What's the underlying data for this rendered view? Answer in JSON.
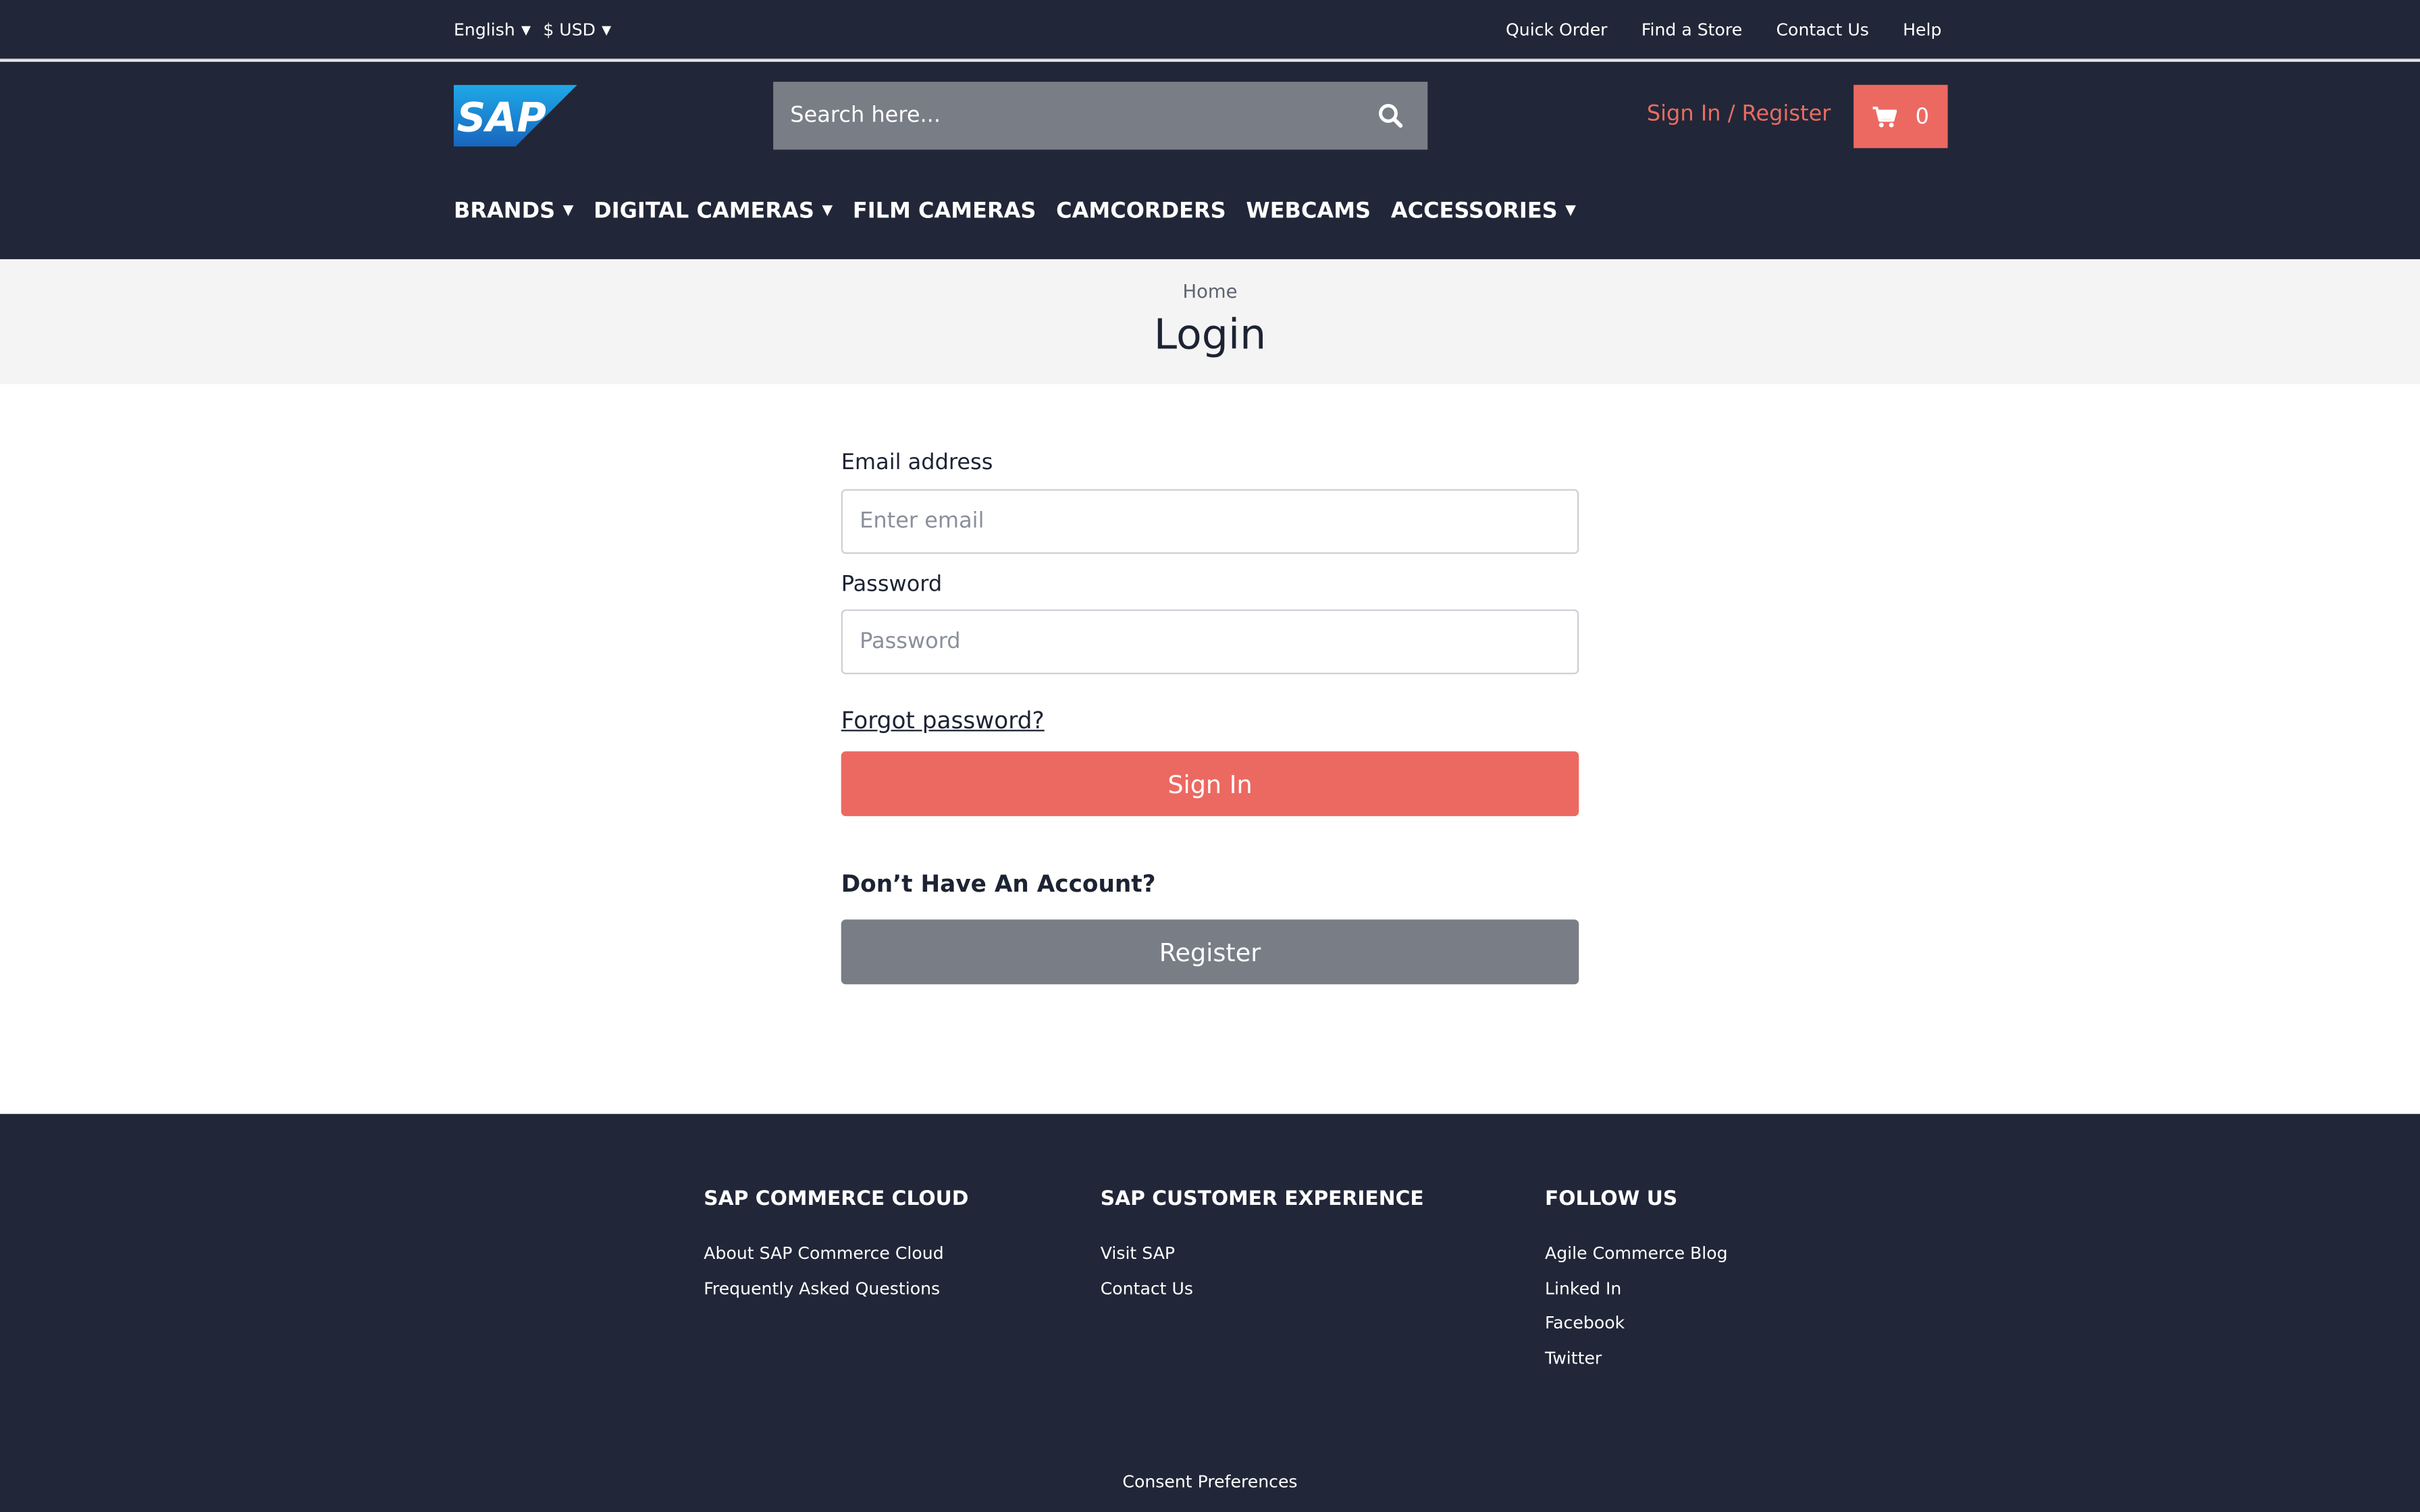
{
  "topbar": {
    "language": "English",
    "currency": "$ USD",
    "links": [
      "Quick Order",
      "Find a Store",
      "Contact Us",
      "Help"
    ]
  },
  "header": {
    "logo_text": "SAP",
    "search_placeholder": "Search here...",
    "signin_register": "Sign In / Register",
    "cart_count": "0"
  },
  "nav": {
    "brands": "BRANDS",
    "digital_cameras": "DIGITAL CAMERAS",
    "film_cameras": "FILM CAMERAS",
    "camcorders": "CAMCORDERS",
    "webcams": "WEBCAMS",
    "accessories": "ACCESSORIES"
  },
  "page": {
    "breadcrumb": "Home",
    "title": "Login"
  },
  "form": {
    "email_label": "Email address",
    "email_placeholder": "Enter email",
    "password_label": "Password",
    "password_placeholder": "Password",
    "forgot": "Forgot password?",
    "signin_button": "Sign In",
    "no_account": "Don’t Have An Account?",
    "register_button": "Register"
  },
  "footer": {
    "col1": {
      "heading": "SAP COMMERCE CLOUD",
      "links": [
        "About SAP Commerce Cloud",
        "Frequently Asked Questions"
      ]
    },
    "col2": {
      "heading": "SAP CUSTOMER EXPERIENCE",
      "links": [
        "Visit SAP",
        "Contact Us"
      ]
    },
    "col3": {
      "heading": "FOLLOW US",
      "links": [
        "Agile Commerce Blog",
        "Linked In",
        "Facebook",
        "Twitter"
      ]
    },
    "consent": "Consent Preferences"
  },
  "colors": {
    "header_bg": "#212738",
    "accent": "#ec6961",
    "register_bg": "#797d86",
    "search_bg": "#797d86",
    "title_band_bg": "#f4f4f4"
  },
  "icons": [
    "chevron-down-icon",
    "search-icon",
    "cart-icon",
    "sap-logo"
  ]
}
